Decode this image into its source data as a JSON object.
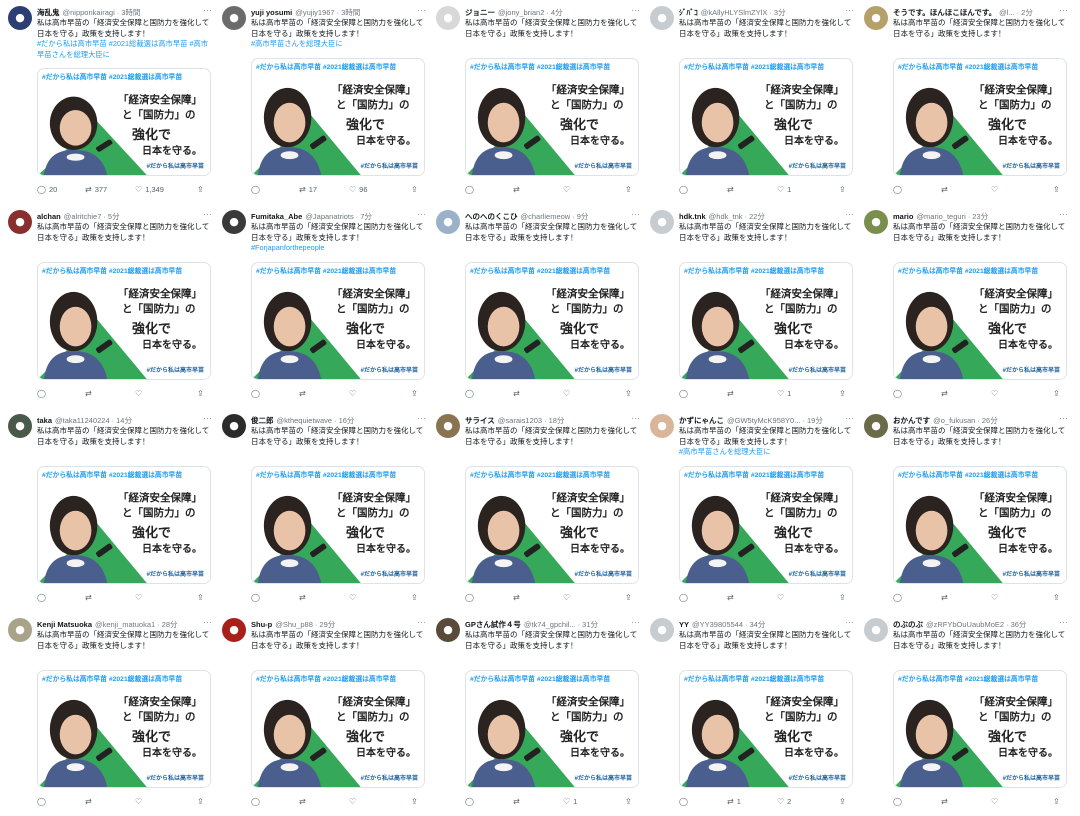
{
  "common": {
    "body_text": "私は高市早苗の「経済安全保障と国防力を強化して日本を守る」政策を支持します！",
    "media": {
      "hashtags": "#だから私は高市早苗 #2021総裁選は高市早苗",
      "slogan_line1": "「経済安全保障」",
      "slogan_line2": "と「国防力」の",
      "slogan_line3": "強化で",
      "slogan_line4": "日本を守る。",
      "slogan_tag": "#だから私は高市早苗"
    },
    "icons": {
      "reply": "reply-icon",
      "retweet": "retweet-icon",
      "like": "like-icon",
      "share": "share-icon",
      "more": "more-icon"
    },
    "colors": {
      "link": "#1d9bf0",
      "muted": "#6e767d",
      "accent_green": "#1f9f47",
      "slogan_blue": "#1a5fa0"
    }
  },
  "tweets": [
    {
      "name": "海乱鬼",
      "handle": "@nipponkairagi",
      "time": "3時間",
      "extra": "#だから私は高市早苗 #2021総裁選は高市早苗 #高市早苗さんを総理大臣に",
      "counts": {
        "reply": "20",
        "retweet": "377",
        "like": "1,349"
      },
      "avatar": "#2c3e73"
    },
    {
      "name": "yuji yosumi",
      "handle": "@yujiy1967",
      "time": "3時間",
      "extra": "#高市早苗さんを総理大臣に",
      "counts": {
        "reply": "",
        "retweet": "17",
        "like": "96"
      },
      "avatar": "#6b6b6b"
    },
    {
      "name": "ジョニー",
      "handle": "@jony_brian2",
      "time": "4分",
      "extra": "",
      "counts": {
        "reply": "",
        "retweet": "",
        "like": ""
      },
      "avatar": "#d8d8d8"
    },
    {
      "name": "ｼﾞﾊﾞｺ",
      "handle": "@kAllyHLYSlmZYlX",
      "time": "3分",
      "extra": "",
      "counts": {
        "reply": "",
        "retweet": "",
        "like": "1"
      },
      "avatar": "#c7ccd1"
    },
    {
      "name": "そうです。ほんほこほんです。",
      "handle": "@l...",
      "time": "2分",
      "extra": "",
      "counts": {
        "reply": "",
        "retweet": "",
        "like": ""
      },
      "avatar": "#b5a06a"
    },
    {
      "name": "alchan",
      "handle": "@alritchie7",
      "time": "5分",
      "extra": "",
      "counts": {
        "reply": "",
        "retweet": "",
        "like": ""
      },
      "avatar": "#8a2f2f"
    },
    {
      "name": "Fumitaka_Abe",
      "handle": "@Japanatriots",
      "time": "7分",
      "extra": "#Forjapanforthepeople",
      "counts": {
        "reply": "",
        "retweet": "",
        "like": ""
      },
      "avatar": "#3a3a3a"
    },
    {
      "name": "へのへのくこひ",
      "handle": "@charliemeow",
      "time": "9分",
      "extra": "",
      "counts": {
        "reply": "",
        "retweet": "",
        "like": ""
      },
      "avatar": "#9bb0c9"
    },
    {
      "name": "hdk.tnk",
      "handle": "@hdk_tnk",
      "time": "22分",
      "extra": "",
      "counts": {
        "reply": "",
        "retweet": "",
        "like": "1"
      },
      "avatar": "#c7ccd1"
    },
    {
      "name": "mario",
      "handle": "@mario_teguri",
      "time": "23分",
      "extra": "",
      "counts": {
        "reply": "",
        "retweet": "",
        "like": ""
      },
      "avatar": "#7a8f4e"
    },
    {
      "name": "taka",
      "handle": "@taka11240224",
      "time": "14分",
      "extra": "",
      "counts": {
        "reply": "",
        "retweet": "",
        "like": ""
      },
      "avatar": "#4a5a4a"
    },
    {
      "name": "俊二郎",
      "handle": "@kthequietwave",
      "time": "16分",
      "extra": "",
      "counts": {
        "reply": "",
        "retweet": "",
        "like": ""
      },
      "avatar": "#2b2b2b"
    },
    {
      "name": "サライス",
      "handle": "@sarais1203",
      "time": "18分",
      "extra": "",
      "counts": {
        "reply": "",
        "retweet": "",
        "like": ""
      },
      "avatar": "#8a7350"
    },
    {
      "name": "かずにゃんこ",
      "handle": "@GW5tyMcK958Y0...",
      "time": "19分",
      "extra": "#高市早苗さんを総理大臣に",
      "counts": {
        "reply": "",
        "retweet": "",
        "like": ""
      },
      "avatar": "#d9b59a"
    },
    {
      "name": "おかんです",
      "handle": "@o_fukusan",
      "time": "26分",
      "extra": "",
      "counts": {
        "reply": "",
        "retweet": "",
        "like": ""
      },
      "avatar": "#6b6b4a"
    },
    {
      "name": "Kenji Matsuoka",
      "handle": "@kenji_matuoka1",
      "time": "28分",
      "extra": "",
      "counts": {
        "reply": "",
        "retweet": "",
        "like": ""
      },
      "avatar": "#a9a38a"
    },
    {
      "name": "Shu-p",
      "handle": "@Shu_p88",
      "time": "29分",
      "extra": "",
      "counts": {
        "reply": "",
        "retweet": "",
        "like": ""
      },
      "avatar": "#a8201a"
    },
    {
      "name": "GPさん試作４号",
      "handle": "@tk74_gpchil...",
      "time": "31分",
      "extra": "",
      "counts": {
        "reply": "",
        "retweet": "",
        "like": "1"
      },
      "avatar": "#5a4a3a"
    },
    {
      "name": "YY",
      "handle": "@YY39805544",
      "time": "34分",
      "extra": "",
      "counts": {
        "reply": "",
        "retweet": "1",
        "like": "2"
      },
      "avatar": "#c7ccd1"
    },
    {
      "name": "のぶのぶ",
      "handle": "@zRFYbOuUaubMoE2",
      "time": "36分",
      "extra": "",
      "counts": {
        "reply": "",
        "retweet": "",
        "like": ""
      },
      "avatar": "#c7ccd1"
    }
  ]
}
